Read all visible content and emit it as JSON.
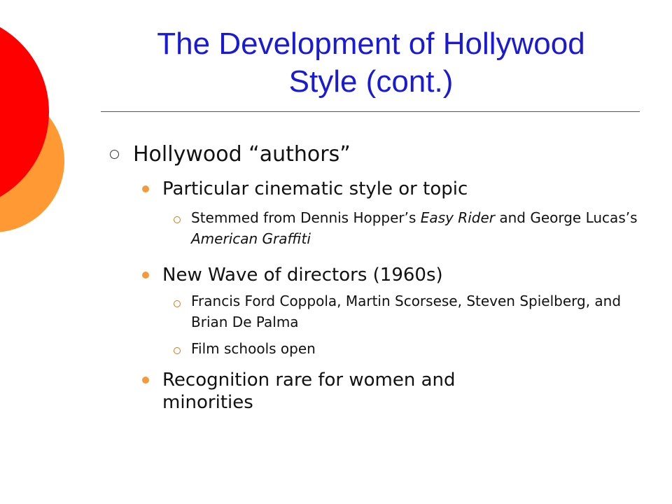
{
  "slide": {
    "title_line1": "The Development of Hollywood",
    "title_line2": "Style (cont.)",
    "colors": {
      "title": "#1a1ad6",
      "red_circle": "#ff0000",
      "orange_circle": "#ff9933",
      "bullet_orange": "#f59a3a"
    }
  },
  "bullets": {
    "main": {
      "text": "Hollywood “authors”"
    },
    "sub1": {
      "text": "Particular cinematic style or topic",
      "detail": {
        "prefix": "Stemmed from Dennis Hopper’s ",
        "film1": "Easy Rider",
        "middle": " and George Lucas’s ",
        "film2": "American Graffiti"
      }
    },
    "sub2": {
      "text": "New Wave of directors (1960s)",
      "detail1": "Francis Ford Coppola, Martin Scorsese, Steven Spielberg, and Brian De Palma",
      "detail2": "Film schools open"
    },
    "sub3": {
      "text_line1": "Recognition rare for women and",
      "text_line2": "minorities"
    }
  }
}
